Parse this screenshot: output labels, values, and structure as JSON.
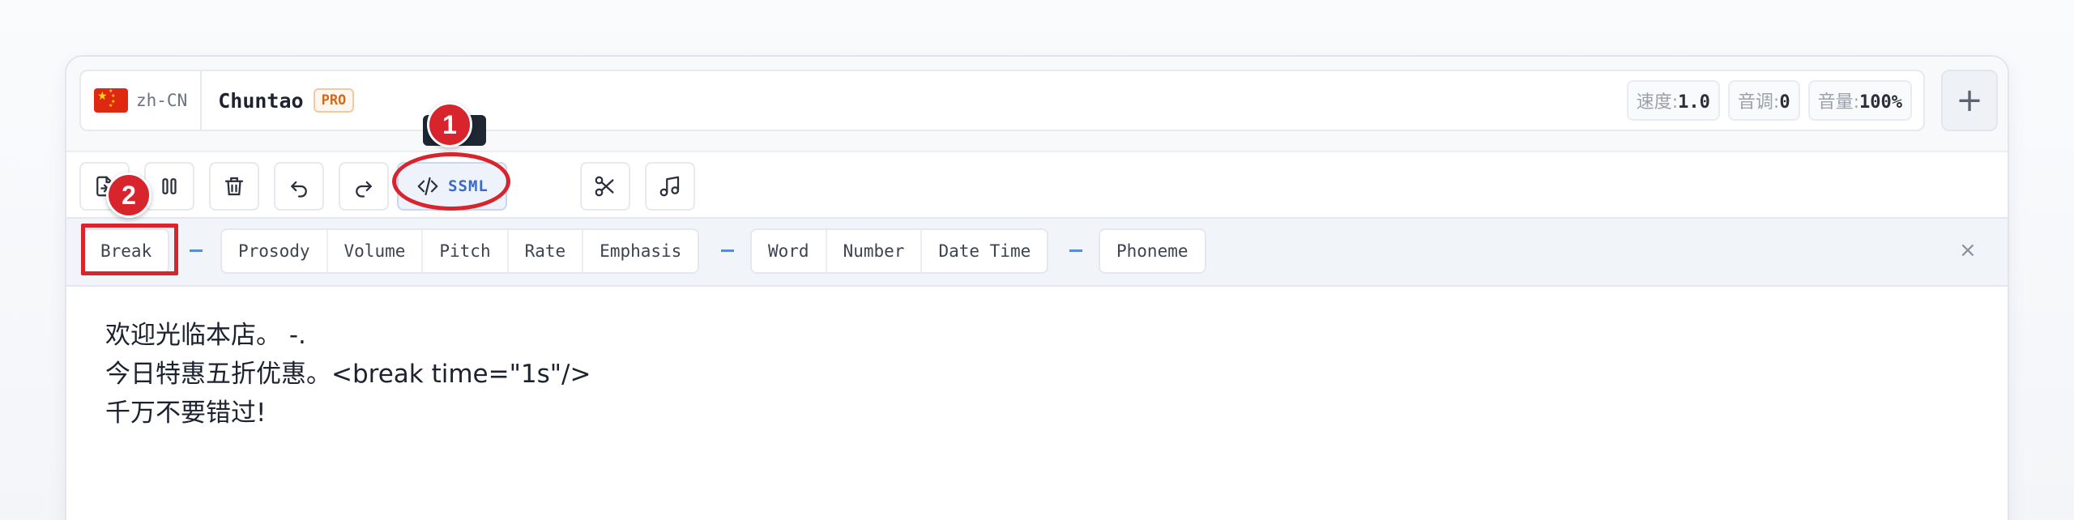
{
  "voice": {
    "locale_code": "zh-CN",
    "flag_icon": "china-flag-icon",
    "name": "Chuntao",
    "badge": "PRO",
    "params": [
      {
        "label": "速度:",
        "value": "1.0"
      },
      {
        "label": "音调:",
        "value": "0"
      },
      {
        "label": "音量:",
        "value": "100%"
      }
    ],
    "add_label": "+"
  },
  "toolbar": {
    "buttons": [
      {
        "name": "import-button",
        "icon": "file-import-icon"
      },
      {
        "name": "pause-button",
        "icon": "pause-icon"
      },
      {
        "name": "delete-button",
        "icon": "trash-icon"
      },
      {
        "name": "undo-button",
        "icon": "undo-icon"
      },
      {
        "name": "redo-button",
        "icon": "redo-icon"
      },
      {
        "name": "cut-button",
        "icon": "scissors-icon"
      },
      {
        "name": "music-button",
        "icon": "music-note-icon"
      }
    ],
    "ssml_label": "SSML",
    "ssml_icon": "code-icon"
  },
  "tags": {
    "group1": [
      "Break"
    ],
    "group2": [
      "Prosody",
      "Volume",
      "Pitch",
      "Rate",
      "Emphasis"
    ],
    "group3": [
      "Word",
      "Number",
      "Date Time"
    ],
    "group4": [
      "Phoneme"
    ],
    "close_label": "×"
  },
  "editor": {
    "lines": [
      "欢迎光临本店。 -.",
      "今日特惠五折优惠。<break time=\"1s\"/>",
      "千万不要错过!"
    ]
  },
  "annotations": {
    "callout_1": "1",
    "callout_2": "2",
    "highlight_color": "#d8242c"
  },
  "colors": {
    "accent": "#3a6ac7",
    "badge_orange": "#d26a1e"
  }
}
